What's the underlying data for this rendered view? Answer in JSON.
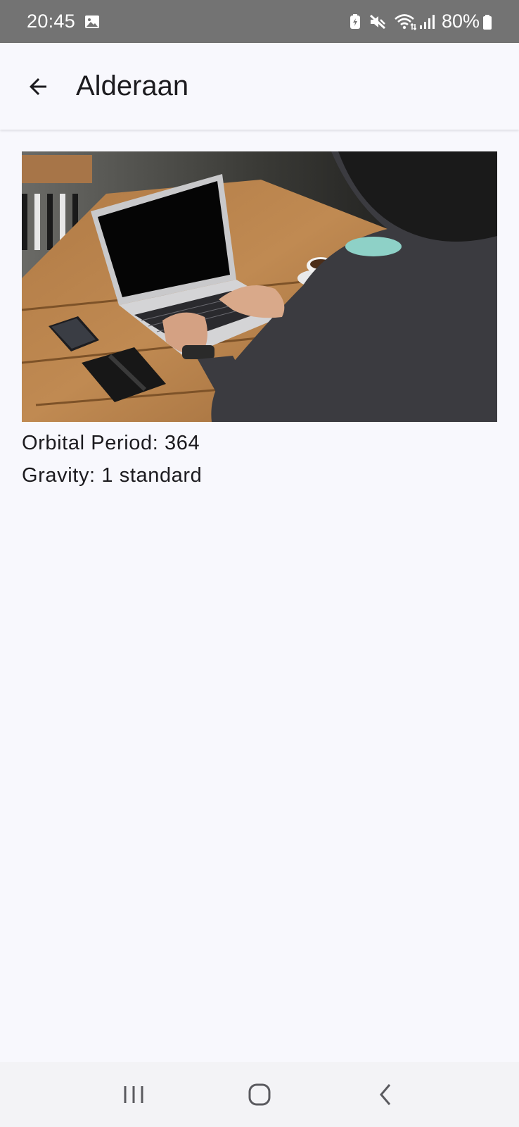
{
  "status_bar": {
    "time": "20:45",
    "battery_percent": "80%",
    "icons": [
      "gallery-icon",
      "battery-saver-icon",
      "mute-icon",
      "wifi-icon",
      "signal-icon",
      "battery-icon"
    ]
  },
  "app_bar": {
    "title": "Alderaan",
    "back_icon": "arrow-back-icon"
  },
  "detail": {
    "image_icon": "laptop-photo",
    "orbital_period": "Orbital Period: 364",
    "gravity": "Gravity: 1 standard"
  },
  "nav_bar": {
    "icons": [
      "recent-apps-icon",
      "home-icon",
      "back-icon"
    ]
  },
  "colors": {
    "status_bar_bg": "#737373",
    "background": "#f8f8fd",
    "text": "#1c1b1f",
    "nav_bar_bg": "#f3f3f6"
  }
}
